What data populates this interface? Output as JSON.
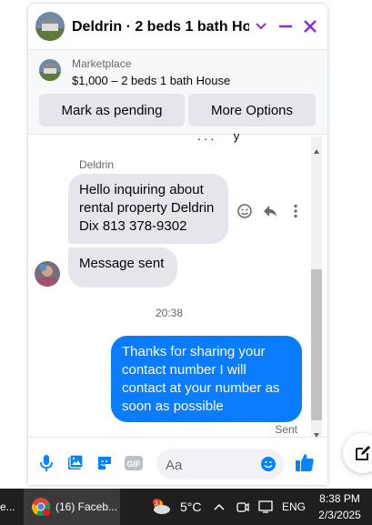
{
  "header": {
    "title": "Deldrin · 2 beds 1 bath Ho...",
    "accent_color": "#8a2be2"
  },
  "marketplace": {
    "label": "Marketplace",
    "listing": "$1,000 – 2 beds 1 bath House",
    "mark_pending_label": "Mark as pending",
    "more_options_label": "More Options"
  },
  "messages": {
    "sender_name": "Deldrin",
    "incoming_1": "Hello inquiring about rental property Deldrin Dix 813 378-9302",
    "incoming_2": "Message sent",
    "timestamp": "20:38",
    "outgoing_1": "Thanks for sharing your contact number I will contact at your number as soon as possible",
    "status": "Sent"
  },
  "composer": {
    "placeholder": "Aa",
    "icons": [
      "microphone-icon",
      "gallery-icon",
      "sticker-icon",
      "gif-icon",
      "emoji-icon",
      "like-icon"
    ]
  },
  "taskbar": {
    "left_fragment": "e...",
    "app_label": "(16) Faceb...",
    "weather": "5°C",
    "language": "ENG",
    "time": "8:38 PM",
    "date": "2/3/2025"
  },
  "colors": {
    "outgoing_bubble": "#0a7cff",
    "incoming_bubble": "#e4e6eb",
    "messenger_blue": "#0084ff"
  }
}
